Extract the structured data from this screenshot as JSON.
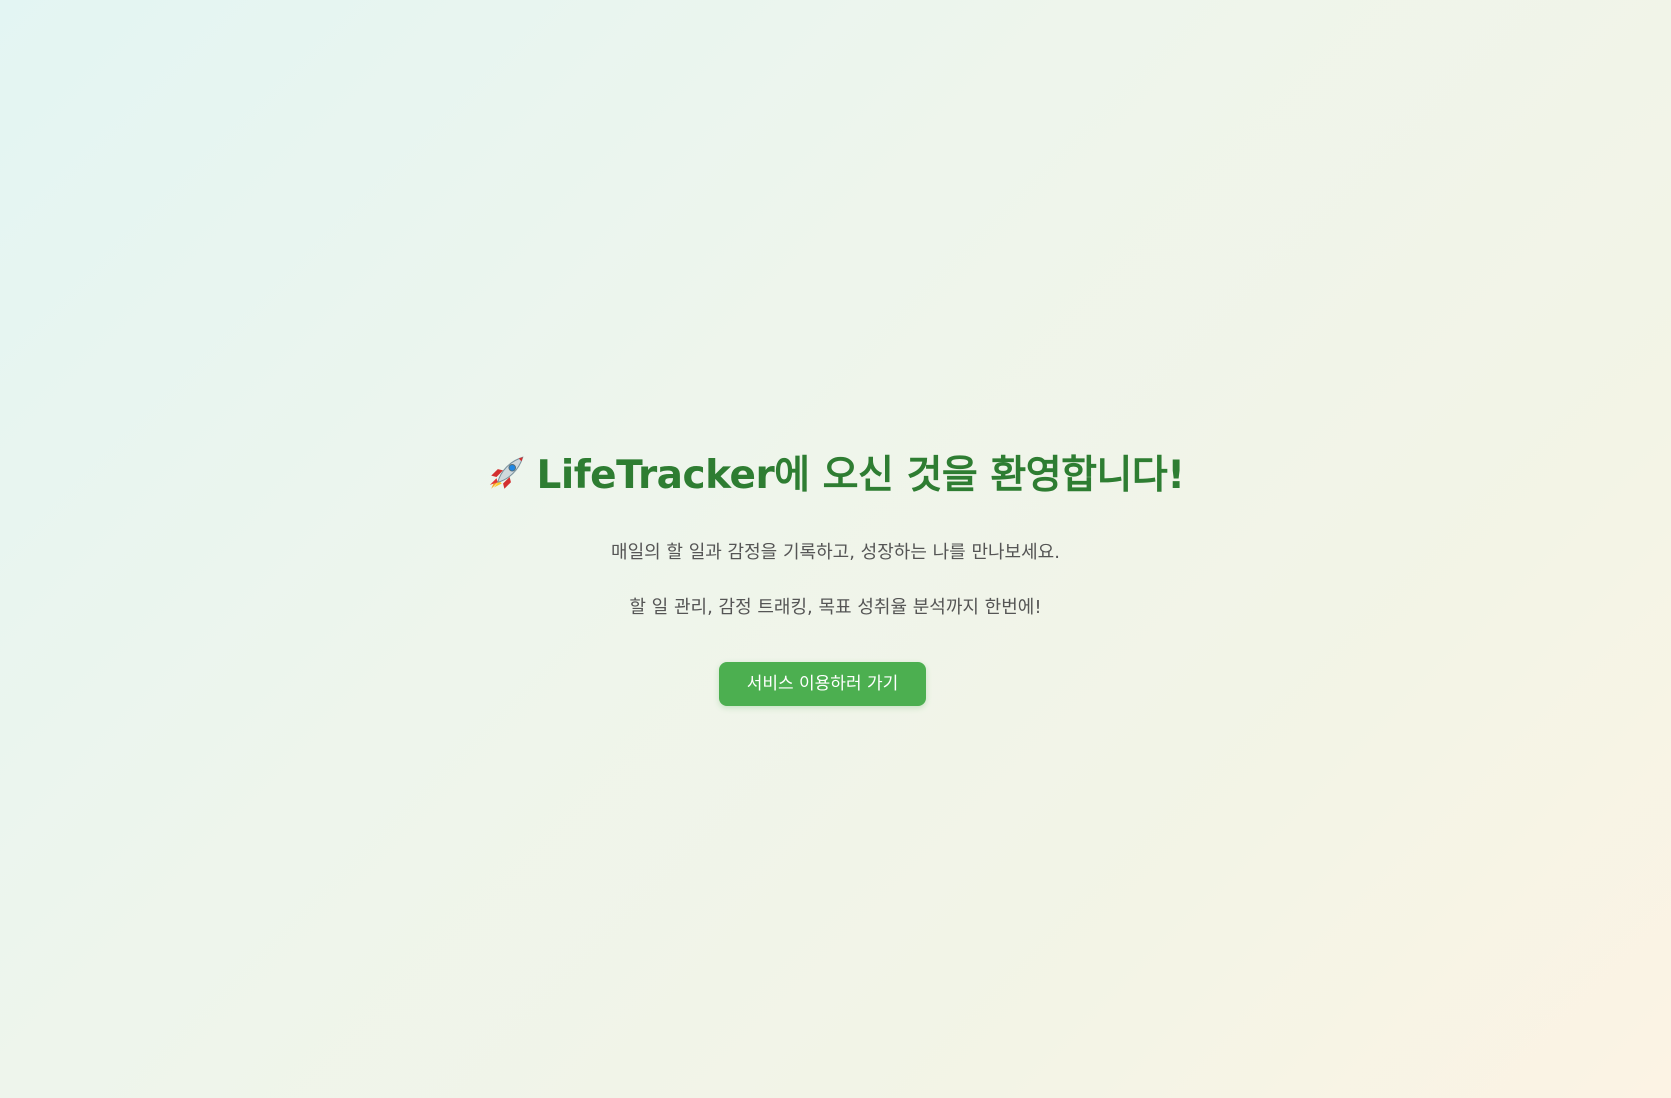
{
  "hero": {
    "icon": "rocket-icon",
    "title": "LifeTracker에 오신 것을 환영합니다!",
    "subtitle_line1": "매일의 할 일과 감정을 기록하고, 성장하는 나를 만나보세요.",
    "subtitle_line2": "할 일 관리, 감정 트래킹, 목표 성취율 분석까지 한번에!",
    "cta_label": "서비스 이용하러 가기"
  },
  "colors": {
    "title": "#2e7d32",
    "button": "#4caf50",
    "button_text": "#ffffff",
    "subtitle": "#555555"
  }
}
